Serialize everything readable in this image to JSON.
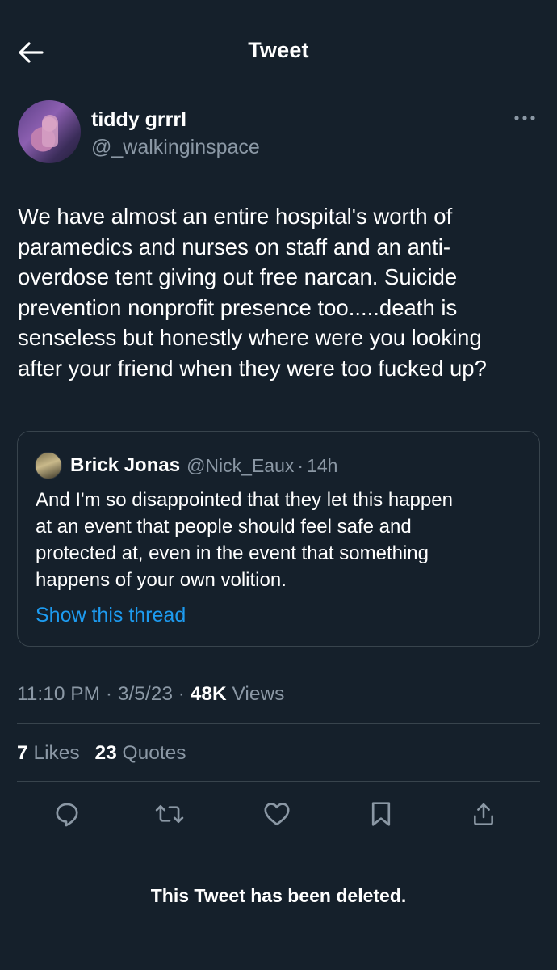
{
  "header": {
    "back_icon": "arrow-left-icon",
    "title": "Tweet"
  },
  "author": {
    "display_name": "tiddy grrrl",
    "handle": "@_walkinginspace",
    "more_icon": "more-horizontal-icon"
  },
  "tweet": {
    "text": "We have almost an entire hospital's worth of\nparamedics and nurses on staff and an anti-\noverdose tent giving out free narcan. Suicide\nprevention nonprofit presence too.....death is\nsenseless but honestly where were you looking\nafter your friend when they were too fucked up?"
  },
  "quote": {
    "name": "Brick Jonas",
    "handle": "@Nick_Eaux",
    "dot": "·",
    "time": "14h",
    "text": "And I'm so disappointed that they let this happen\nat an event that people should feel safe and\nprotected at, even in the event that something\nhappens of your own volition.",
    "show_thread": "Show this thread"
  },
  "meta": {
    "time": "11:10 PM",
    "sep1": " · ",
    "date": "3/5/23",
    "sep2": " · ",
    "views_count": "48K",
    "views_label": " Views"
  },
  "stats": {
    "likes_count": "7",
    "likes_label": " Likes",
    "quotes_count": "23",
    "quotes_label": " Quotes"
  },
  "actions": {
    "reply_icon": "reply-icon",
    "retweet_icon": "retweet-icon",
    "like_icon": "heart-icon",
    "bookmark_icon": "bookmark-icon",
    "share_icon": "share-icon"
  },
  "notice": {
    "deleted": "This Tweet has been deleted."
  },
  "colors": {
    "background": "#15202b",
    "secondary_text": "#8b98a5",
    "link": "#1d9bf0",
    "border": "#38444d"
  }
}
